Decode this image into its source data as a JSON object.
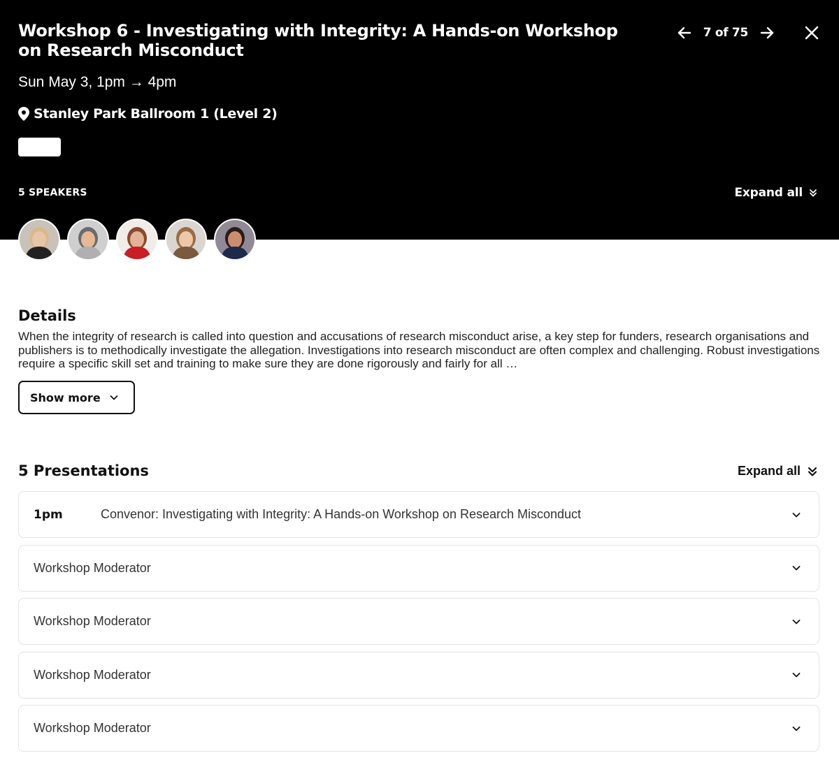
{
  "session": {
    "title": "Workshop 6 - Investigating with Integrity: A Hands-on Workshop on Research Misconduct",
    "datetime": "Sun May 3, 1pm → 4pm",
    "location": "Stanley Park Ballroom 1 (Level 2)"
  },
  "nav": {
    "counter": "7 of 75",
    "prev_icon": "arrow-left-icon",
    "next_icon": "arrow-right-icon",
    "close_icon": "close-icon"
  },
  "speakers": {
    "label": "5 SPEAKERS",
    "expand_label": "Expand all",
    "avatars": [
      {
        "bg": "#c9c2b8",
        "hair": "#d8b98a",
        "skin": "#e8c4a8",
        "shirt": "#222222"
      },
      {
        "bg": "#cfcfcf",
        "hair": "#6b6b6b",
        "skin": "#e6b896",
        "shirt": "#b0b0b0"
      },
      {
        "bg": "#f0ecea",
        "hair": "#8a4a2a",
        "skin": "#e2b394",
        "shirt": "#c81e24"
      },
      {
        "bg": "#d9d6d2",
        "hair": "#9a6c44",
        "skin": "#eec7a9",
        "shirt": "#7b5a3e"
      },
      {
        "bg": "#8f8a96",
        "hair": "#2a1d1a",
        "skin": "#c8906e",
        "shirt": "#1e2a4a"
      }
    ]
  },
  "details": {
    "heading": "Details",
    "text": "When the integrity of research is called into question and accusations of research misconduct arise, a key step for funders, research organisations and publishers is to methodically investigate the allegation. Investigations into research misconduct are often complex and challenging.  Robust investigations require a specific skill set and training to make sure they are done rigorously and fairly for all …",
    "show_more_label": "Show more"
  },
  "presentations": {
    "heading": "5 Presentations",
    "expand_label": "Expand all",
    "items": [
      {
        "time": "1pm",
        "title": "Convenor: Investigating with Integrity: A Hands-on Workshop on Research Misconduct"
      },
      {
        "time": "",
        "title": "Workshop Moderator"
      },
      {
        "time": "",
        "title": "Workshop Moderator"
      },
      {
        "time": "",
        "title": "Workshop Moderator"
      },
      {
        "time": "",
        "title": "Workshop Moderator"
      }
    ]
  },
  "colors": {
    "header_bg": "#000000",
    "page_bg": "#ffffff",
    "card_border": "#e3e3e3"
  }
}
